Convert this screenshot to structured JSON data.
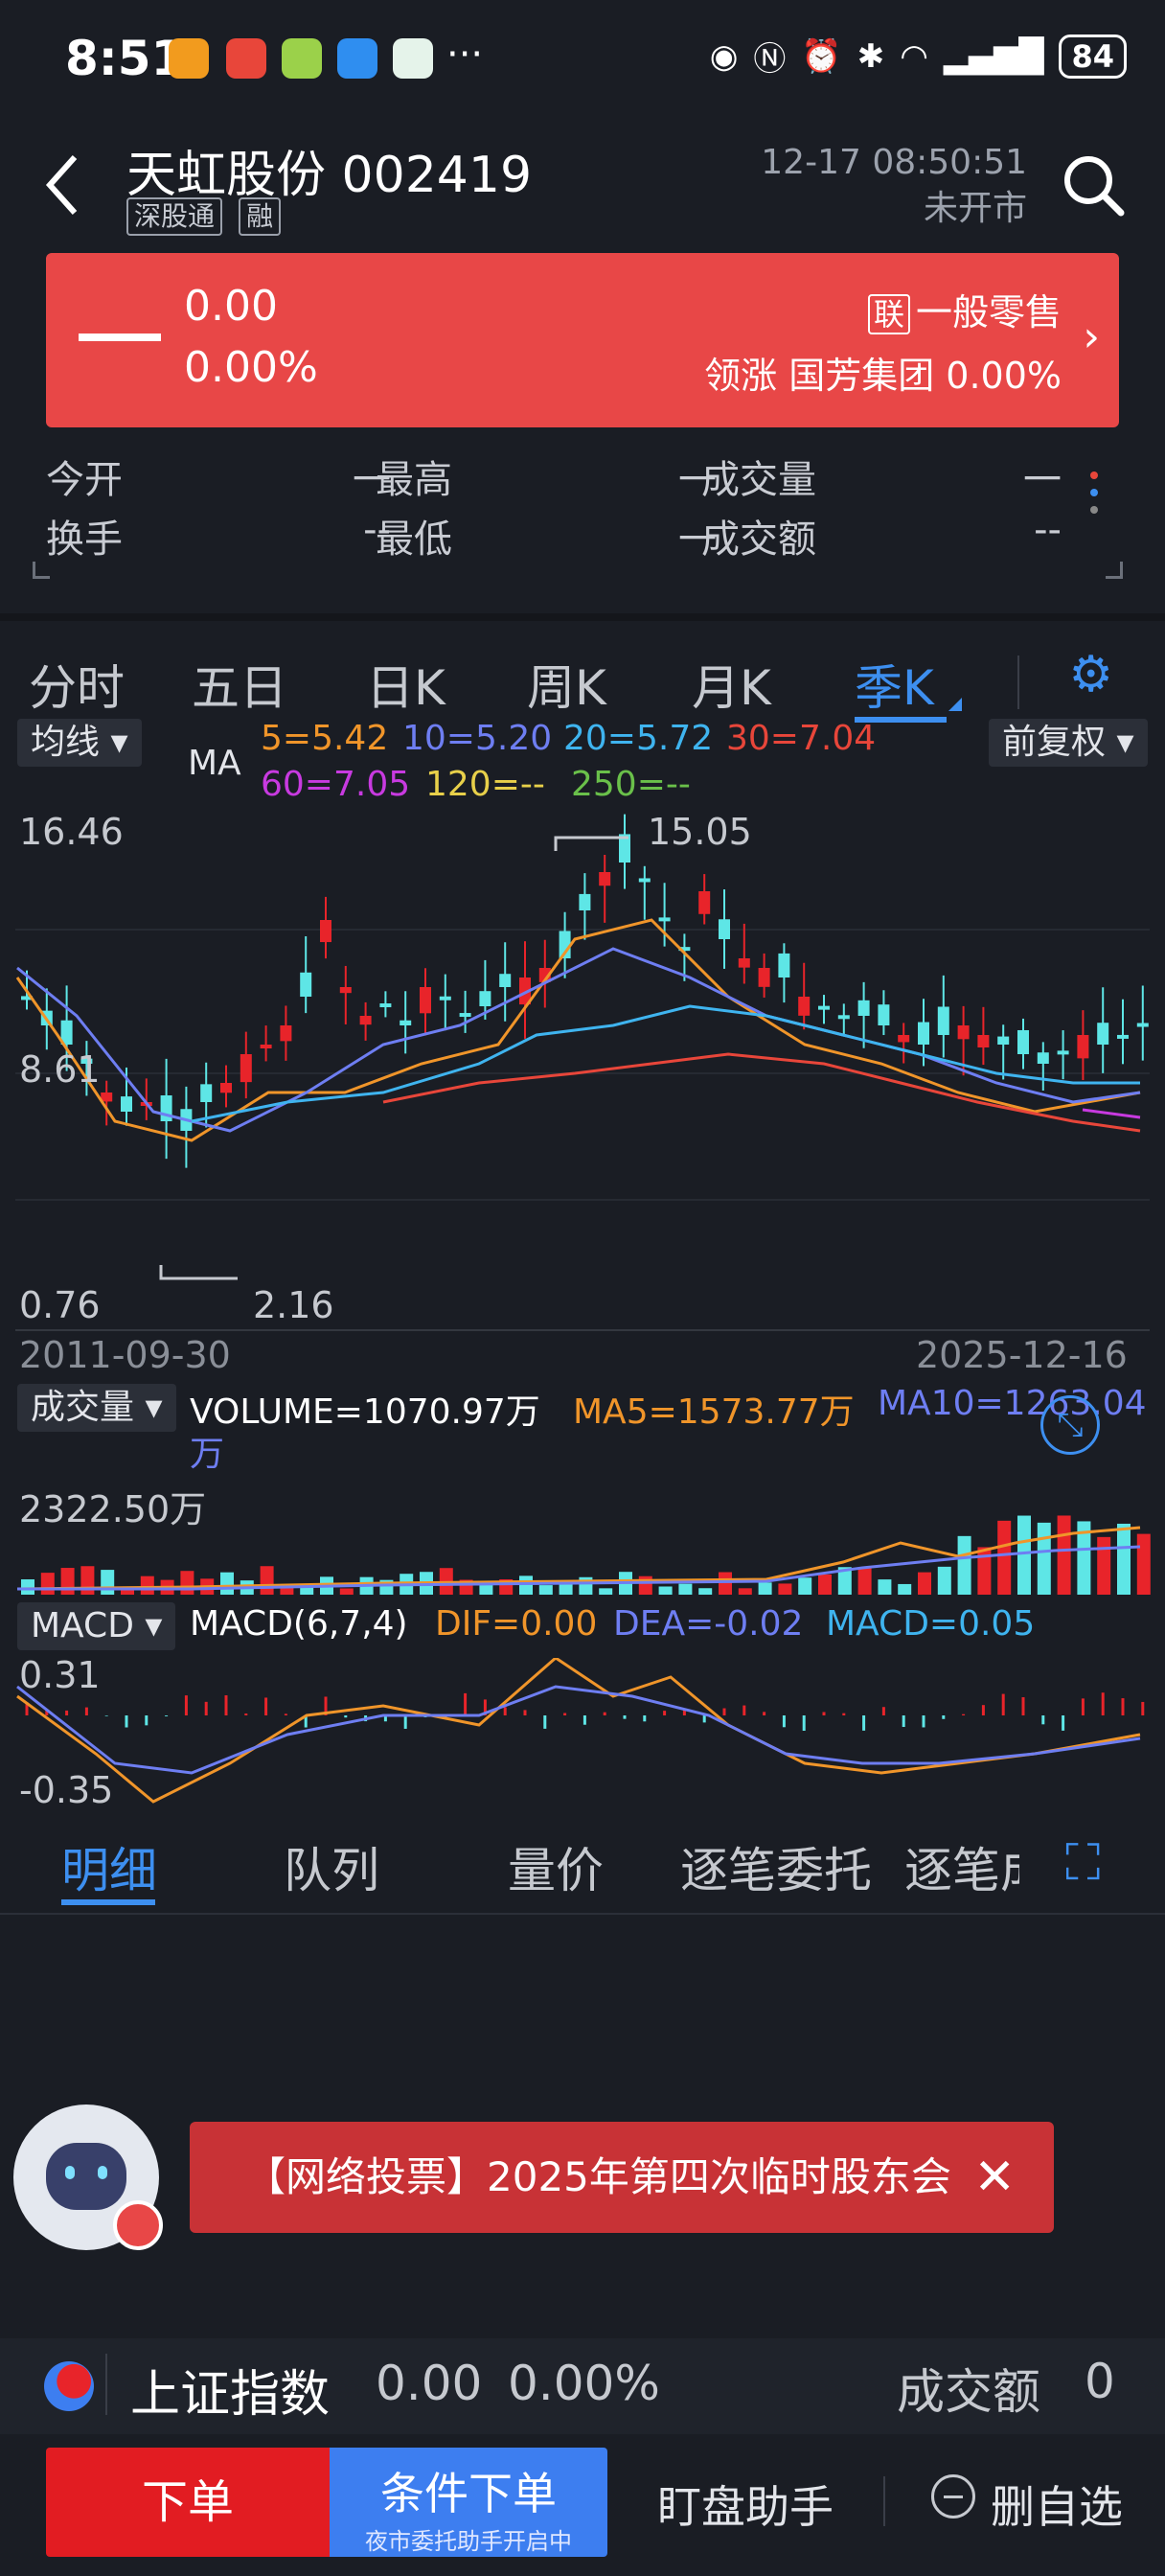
{
  "status": {
    "time": "8:51",
    "battery": "84"
  },
  "header": {
    "stock_name": "天虹股份 002419",
    "tags": [
      "深股通",
      "融"
    ],
    "date": "12-17 08:50:51",
    "market_status": "未开市"
  },
  "banner": {
    "price": "0.00",
    "change_pct": "0.00%",
    "lian": "联",
    "sector": "一般零售",
    "leader_label": "领涨",
    "leader": "国芳集团 0.00%"
  },
  "stats": {
    "row1": [
      {
        "label": "今开",
        "value": "一"
      },
      {
        "label": "最高",
        "value": "一"
      },
      {
        "label": "成交量",
        "value": "一"
      }
    ],
    "row2": [
      {
        "label": "换手",
        "value": "--"
      },
      {
        "label": "最低",
        "value": "一"
      },
      {
        "label": "成交额",
        "value": "--"
      }
    ]
  },
  "tabs": [
    "分时",
    "五日",
    "日K",
    "周K",
    "月K",
    "季K"
  ],
  "ma": {
    "selector": "均线",
    "label": "MA",
    "ma5": "5=5.42",
    "ma10": "10=5.20",
    "ma20": "20=5.72",
    "ma30": "30=7.04",
    "ma60": "60=7.05",
    "ma120": "120=--",
    "ma250": "250=--",
    "adjust": "前复权"
  },
  "axis": {
    "top": "16.46",
    "mid": "8.61",
    "bottom": "0.76",
    "high_mark": "15.05",
    "low_mark": "2.16",
    "start_date": "2011-09-30",
    "end_date": "2025-12-16"
  },
  "volume": {
    "selector": "成交量",
    "label": "VOLUME=1070.97万",
    "ma5": "MA5=1573.77万",
    "ma10": "MA10=1263.04",
    "ma10_unit": "万",
    "max": "2322.50万"
  },
  "macd": {
    "selector": "MACD",
    "label": "MACD(6,7,4)",
    "dif": "DIF=0.00",
    "dea": "DEA=-0.02",
    "macd": "MACD=0.05",
    "top": "0.31",
    "bottom": "-0.35"
  },
  "subtabs": [
    "明细",
    "队列",
    "量价",
    "逐笔委托",
    "逐笔成交"
  ],
  "notice": {
    "text": "【网络投票】2025年第四次临时股东会"
  },
  "index": {
    "name": "上证指数",
    "value": "0.00",
    "pct": "0.00%",
    "turnover_label": "成交额",
    "turnover": "0"
  },
  "bottom": {
    "order": "下单",
    "cond_order": "条件下单",
    "cond_sub": "夜市委托助手开启中",
    "helper": "盯盘助手",
    "remove": "删自选"
  },
  "colors": {
    "up": "#e8242a",
    "down": "#5ee6e6",
    "accent": "#3d8ff0",
    "ma5": "#f0952a",
    "ma10": "#6e7ef2",
    "ma20": "#3fb4ef",
    "ma30": "#e8463a",
    "ma60": "#c83ae0",
    "ma120": "#e8d04a",
    "ma250": "#6ac04a"
  }
}
